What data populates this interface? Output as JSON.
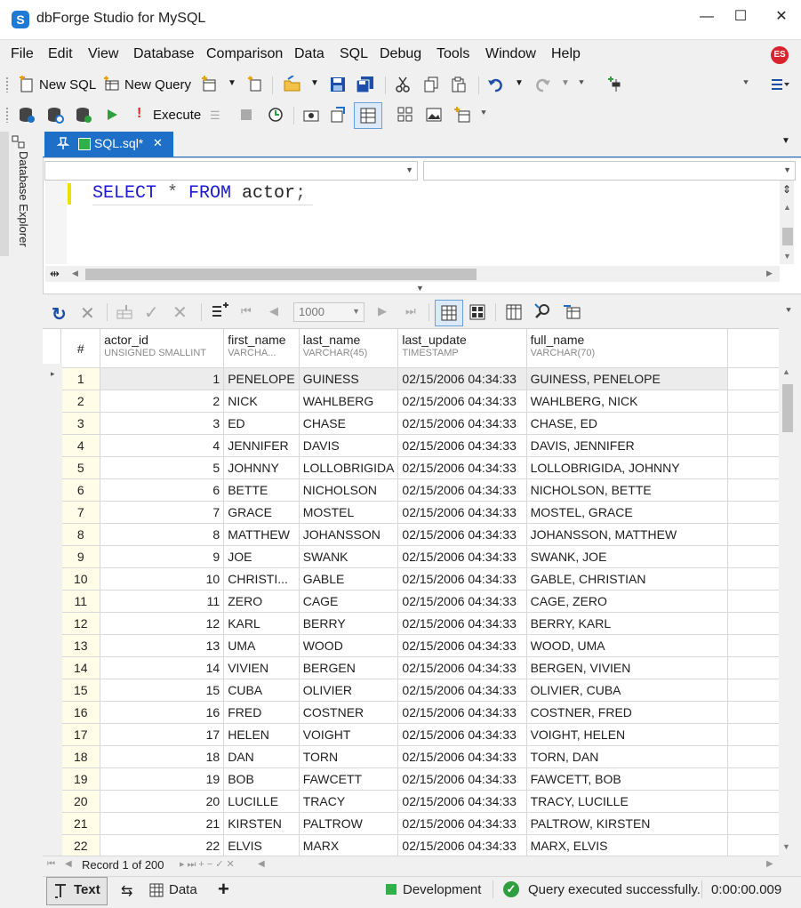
{
  "app": {
    "title": "dbForge Studio for MySQL",
    "logo_letter": "S",
    "user_initials": "ES"
  },
  "window_controls": {
    "minimize": "—",
    "maximize": "☐",
    "close": "✕"
  },
  "menu": [
    "File",
    "Edit",
    "View",
    "Database",
    "Comparison",
    "Data",
    "SQL",
    "Debug",
    "Tools",
    "Window",
    "Help"
  ],
  "toolbar1": {
    "new_sql": "New SQL",
    "new_query": "New Query"
  },
  "toolbar2": {
    "execute": "Execute"
  },
  "sidebar": {
    "database_explorer": "Database Explorer"
  },
  "document_tab": {
    "label": "SQL.sql*"
  },
  "editor": {
    "kw_select": "SELECT",
    "star": " * ",
    "kw_from": "FROM",
    "table": " actor",
    "semicolon": ";"
  },
  "grid_toolbar": {
    "page_size": "1000"
  },
  "grid": {
    "row_header": "#",
    "columns": [
      {
        "name": "actor_id",
        "type": "UNSIGNED SMALLINT"
      },
      {
        "name": "first_name",
        "type": "VARCHA..."
      },
      {
        "name": "last_name",
        "type": "VARCHAR(45)"
      },
      {
        "name": "last_update",
        "type": "TIMESTAMP"
      },
      {
        "name": "full_name",
        "type": "VARCHAR(70)"
      }
    ],
    "rows": [
      [
        "1",
        "1",
        "PENELOPE",
        "GUINESS",
        "02/15/2006 04:34:33",
        "GUINESS, PENELOPE"
      ],
      [
        "2",
        "2",
        "NICK",
        "WAHLBERG",
        "02/15/2006 04:34:33",
        "WAHLBERG, NICK"
      ],
      [
        "3",
        "3",
        "ED",
        "CHASE",
        "02/15/2006 04:34:33",
        "CHASE, ED"
      ],
      [
        "4",
        "4",
        "JENNIFER",
        "DAVIS",
        "02/15/2006 04:34:33",
        "DAVIS, JENNIFER"
      ],
      [
        "5",
        "5",
        "JOHNNY",
        "LOLLOBRIGIDA",
        "02/15/2006 04:34:33",
        "LOLLOBRIGIDA, JOHNNY"
      ],
      [
        "6",
        "6",
        "BETTE",
        "NICHOLSON",
        "02/15/2006 04:34:33",
        "NICHOLSON, BETTE"
      ],
      [
        "7",
        "7",
        "GRACE",
        "MOSTEL",
        "02/15/2006 04:34:33",
        "MOSTEL, GRACE"
      ],
      [
        "8",
        "8",
        "MATTHEW",
        "JOHANSSON",
        "02/15/2006 04:34:33",
        "JOHANSSON, MATTHEW"
      ],
      [
        "9",
        "9",
        "JOE",
        "SWANK",
        "02/15/2006 04:34:33",
        "SWANK, JOE"
      ],
      [
        "10",
        "10",
        "CHRISTI...",
        "GABLE",
        "02/15/2006 04:34:33",
        "GABLE, CHRISTIAN"
      ],
      [
        "11",
        "11",
        "ZERO",
        "CAGE",
        "02/15/2006 04:34:33",
        "CAGE, ZERO"
      ],
      [
        "12",
        "12",
        "KARL",
        "BERRY",
        "02/15/2006 04:34:33",
        "BERRY, KARL"
      ],
      [
        "13",
        "13",
        "UMA",
        "WOOD",
        "02/15/2006 04:34:33",
        "WOOD, UMA"
      ],
      [
        "14",
        "14",
        "VIVIEN",
        "BERGEN",
        "02/15/2006 04:34:33",
        "BERGEN, VIVIEN"
      ],
      [
        "15",
        "15",
        "CUBA",
        "OLIVIER",
        "02/15/2006 04:34:33",
        "OLIVIER, CUBA"
      ],
      [
        "16",
        "16",
        "FRED",
        "COSTNER",
        "02/15/2006 04:34:33",
        "COSTNER, FRED"
      ],
      [
        "17",
        "17",
        "HELEN",
        "VOIGHT",
        "02/15/2006 04:34:33",
        "VOIGHT, HELEN"
      ],
      [
        "18",
        "18",
        "DAN",
        "TORN",
        "02/15/2006 04:34:33",
        "TORN, DAN"
      ],
      [
        "19",
        "19",
        "BOB",
        "FAWCETT",
        "02/15/2006 04:34:33",
        "FAWCETT, BOB"
      ],
      [
        "20",
        "20",
        "LUCILLE",
        "TRACY",
        "02/15/2006 04:34:33",
        "TRACY, LUCILLE"
      ],
      [
        "21",
        "21",
        "KIRSTEN",
        "PALTROW",
        "02/15/2006 04:34:33",
        "PALTROW, KIRSTEN"
      ],
      [
        "22",
        "22",
        "ELVIS",
        "MARX",
        "02/15/2006 04:34:33",
        "MARX, ELVIS"
      ]
    ]
  },
  "navigator": {
    "record": "Record 1 of 200"
  },
  "status": {
    "text_tab": "Text",
    "data_tab": "Data",
    "add": "+",
    "connection": "Development",
    "message": "Query executed successfully.",
    "elapsed": "0:00:00.009"
  },
  "colors": {
    "accent": "#1e6fc8",
    "success": "#2e9e3e",
    "connection": "#2fb04a",
    "avatar": "#d9232e"
  }
}
